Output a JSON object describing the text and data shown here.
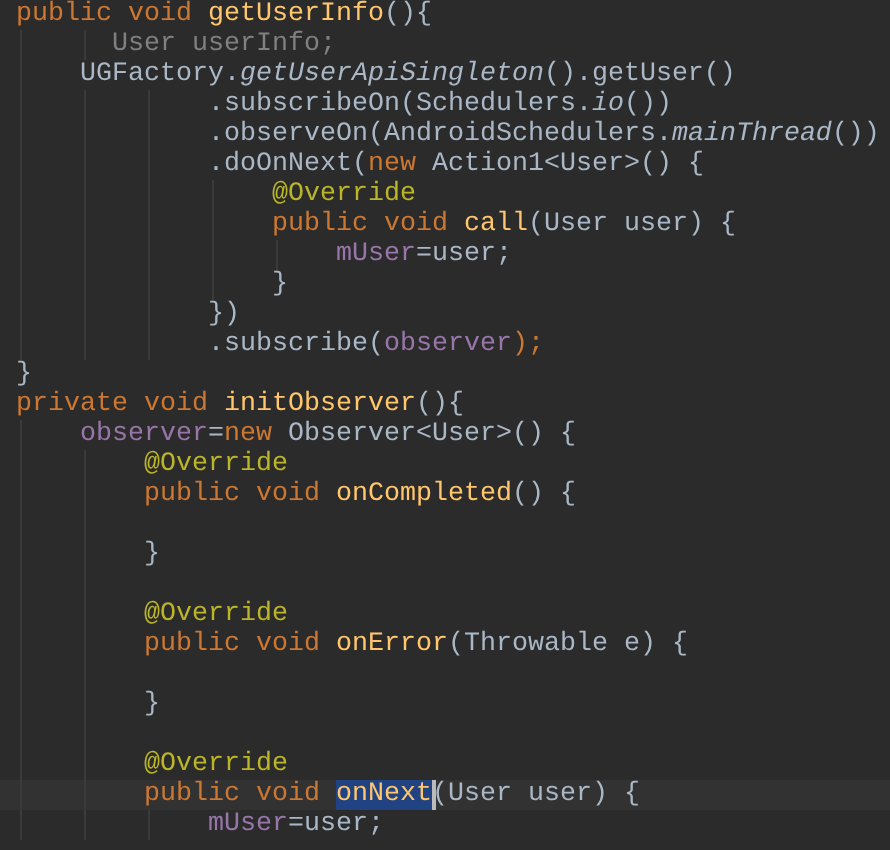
{
  "editor": {
    "lines": [
      {
        "tokens": [
          {
            "text": "public void ",
            "kind": "keyword"
          },
          {
            "text": "getUserInfo",
            "kind": "method"
          },
          {
            "text": "(){",
            "kind": "plain"
          }
        ]
      },
      {
        "tokens": [
          {
            "text": "      User userInfo;",
            "kind": "unused"
          }
        ]
      },
      {
        "tokens": [
          {
            "text": "    UGFactory.",
            "kind": "plain"
          },
          {
            "text": "getUserApiSingleton",
            "kind": "static"
          },
          {
            "text": "().getUser()",
            "kind": "plain"
          }
        ]
      },
      {
        "tokens": [
          {
            "text": "            .subscribeOn(Schedulers.",
            "kind": "plain"
          },
          {
            "text": "io",
            "kind": "static"
          },
          {
            "text": "())",
            "kind": "plain"
          }
        ]
      },
      {
        "tokens": [
          {
            "text": "            .observeOn(AndroidSchedulers.",
            "kind": "plain"
          },
          {
            "text": "mainThread",
            "kind": "static"
          },
          {
            "text": "())",
            "kind": "plain"
          }
        ]
      },
      {
        "tokens": [
          {
            "text": "            .doOnNext(",
            "kind": "plain"
          },
          {
            "text": "new ",
            "kind": "keyword"
          },
          {
            "text": "Action1<User>() {",
            "kind": "plain"
          }
        ]
      },
      {
        "tokens": [
          {
            "text": "                @Override",
            "kind": "annotation"
          }
        ]
      },
      {
        "tokens": [
          {
            "text": "                public void ",
            "kind": "keyword"
          },
          {
            "text": "call",
            "kind": "method"
          },
          {
            "text": "(User user) {",
            "kind": "plain"
          }
        ]
      },
      {
        "tokens": [
          {
            "text": "                    mUser",
            "kind": "field"
          },
          {
            "text": "=user;",
            "kind": "plain"
          }
        ]
      },
      {
        "tokens": [
          {
            "text": "                }",
            "kind": "plain"
          }
        ]
      },
      {
        "tokens": [
          {
            "text": "            })",
            "kind": "plain"
          }
        ]
      },
      {
        "tokens": [
          {
            "text": "            .subscribe(",
            "kind": "plain"
          },
          {
            "text": "observer",
            "kind": "field"
          },
          {
            "text": ");",
            "kind": "keyword"
          }
        ]
      },
      {
        "tokens": [
          {
            "text": "}",
            "kind": "plain"
          }
        ]
      },
      {
        "tokens": [
          {
            "text": "private void ",
            "kind": "keyword"
          },
          {
            "text": "initObserver",
            "kind": "method"
          },
          {
            "text": "(){",
            "kind": "plain"
          }
        ]
      },
      {
        "tokens": [
          {
            "text": "    observer",
            "kind": "field"
          },
          {
            "text": "=",
            "kind": "plain"
          },
          {
            "text": "new ",
            "kind": "keyword"
          },
          {
            "text": "Observer<User>() {",
            "kind": "plain"
          }
        ]
      },
      {
        "tokens": [
          {
            "text": "        @Override",
            "kind": "annotation"
          }
        ]
      },
      {
        "tokens": [
          {
            "text": "        public void ",
            "kind": "keyword"
          },
          {
            "text": "onCompleted",
            "kind": "method"
          },
          {
            "text": "() {",
            "kind": "plain"
          }
        ]
      },
      {
        "kind": "blank"
      },
      {
        "tokens": [
          {
            "text": "        }",
            "kind": "plain"
          }
        ]
      },
      {
        "kind": "blank"
      },
      {
        "tokens": [
          {
            "text": "        @Override",
            "kind": "annotation"
          }
        ]
      },
      {
        "tokens": [
          {
            "text": "        public void ",
            "kind": "keyword"
          },
          {
            "text": "onError",
            "kind": "method"
          },
          {
            "text": "(Throwable e) {",
            "kind": "plain"
          }
        ]
      },
      {
        "kind": "blank"
      },
      {
        "tokens": [
          {
            "text": "        }",
            "kind": "plain"
          }
        ]
      },
      {
        "kind": "blank"
      },
      {
        "tokens": [
          {
            "text": "        @Override",
            "kind": "annotation"
          }
        ]
      },
      {
        "tokens": [
          {
            "text": "        public void ",
            "kind": "keyword",
            "selected": false
          },
          {
            "text": "onNext",
            "kind": "method",
            "selected": true
          },
          {
            "text": "(User user) {",
            "kind": "plain",
            "selected": false
          }
        ]
      },
      {
        "tokens": [
          {
            "text": "            mUser",
            "kind": "field"
          },
          {
            "text": "=user;",
            "kind": "plain"
          }
        ]
      }
    ]
  }
}
